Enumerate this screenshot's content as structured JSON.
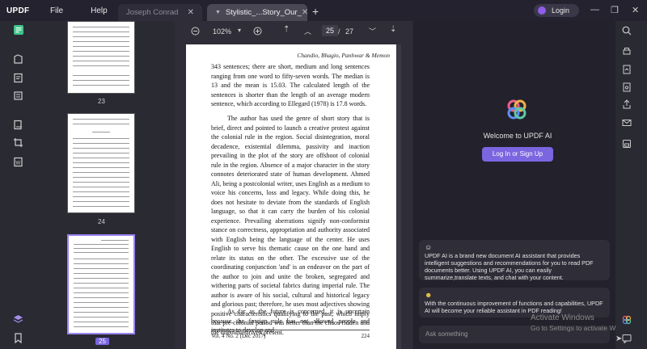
{
  "app": {
    "logo": "UPDF",
    "menu": [
      "File",
      "Help"
    ]
  },
  "tabs": [
    {
      "label": "Joseph Conrad"
    },
    {
      "label": "Stylistic_...Story_Our_"
    }
  ],
  "account": {
    "login_label": "Login"
  },
  "toolbar": {
    "zoom": "102%",
    "current_page": "25",
    "page_separator": "/",
    "total_pages": "27"
  },
  "thumbnails": {
    "pages": [
      "23",
      "24",
      "25"
    ]
  },
  "document": {
    "running_head": "Chandio, Bhagio, Panhwar & Memon",
    "para1": "343 sentences; there are short, medium and long sentences ranging from one word to fifty-seven words. The median is 13 and the mean is 15.03. The calculated length of the sentences is shorter than the length of an average modern sentence, which according to Ellegard (1978) is 17.8 words.",
    "para2": "The author has used the genre of short story that is brief, direct and pointed to launch a creative protest against the colonial rule in the region. Social disintegration, moral decadence, existential dilemma, passivity and inaction prevailing in the plot of the story are offshoot of colonial rule in the region. Absence of a major character in the story connotes deteriorated state of human development. Ahmed Ali, being a postcolonial writer, uses English as a medium to voice his concerns, loss and legacy. While doing this, he does not hesitate to deviate from the standards of English language, so that it can carry the burden of his colonial experience. Prevailing aberrations signify non-conformist stance on correctness, appropriation and authority associated with English being the language of the center. He uses English to serve his thematic cause on the one hand and relate its status on the other. The excessive use of the coordinating conjunction 'and' is an endeavor on the part of the author to join and unite the broken, segregated and withering parts of societal fabrics during imperial rule. The author is aware of his social, cultural and historical legacy and glorious past; therefore, he uses most adjectives showing positive characteristics qualifying to the past, which imply that pre-colonial period was better than the chaos-ridden and the dilemma-driven present.",
    "para3": "As far as the future is concerned, it is uncertain because the foreign rule has not allowed people and institutes to develop and",
    "footer_left": "Vol. 4 No. 2 (Dec 2017)",
    "footer_right": "224"
  },
  "ai": {
    "welcome": "Welcome to UPDF AI",
    "signup_label": "Log In or Sign Up",
    "msg1": "UPDF AI is a brand new document AI assistant that provides intelligent suggestions and recommendations for you to read PDF documents better. Using UPDF AI, you can easily summarize,translate texts, and chat with your content.",
    "msg2": "With the continuous improvement of functions and capabilities, UPDF AI will become your reliable assistant in PDF reading!",
    "input_placeholder": "Ask something"
  },
  "watermark": {
    "line1": "Activate Windows",
    "line2": "Go to Settings to activate Windows."
  },
  "colors": {
    "accent": "#7b65e0",
    "titlebar": "#24222e",
    "panel": "#23222c"
  }
}
